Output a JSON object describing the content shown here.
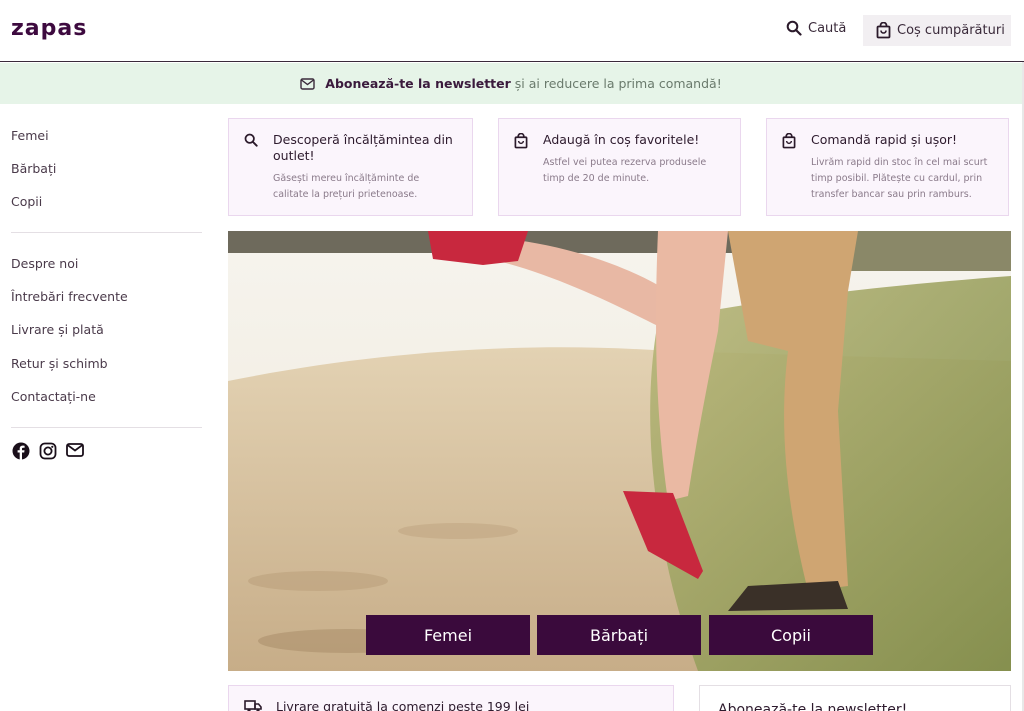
{
  "header": {
    "logo": "zapas",
    "search_label": "Caută",
    "cart_label": "Coș cumpărături"
  },
  "newsletter_bar": {
    "bold": "Abonează-te la newsletter",
    "rest": "și ai reducere la prima comandă!"
  },
  "sidebar": {
    "categories": [
      "Femei",
      "Bărbați",
      "Copii"
    ],
    "pages": [
      "Despre noi",
      "Întrebări frecvente",
      "Livrare și plată",
      "Retur și schimb",
      "Contactați-ne"
    ]
  },
  "cards": [
    {
      "icon": "search-icon",
      "title": "Descoperă încălțămintea din outlet!",
      "desc": "Găsești mereu încălțăminte de calitate la prețuri prietenoase."
    },
    {
      "icon": "shopping-bag-icon",
      "title": "Adaugă în coș favoritele!",
      "desc": "Astfel vei putea rezerva produsele timp de 20 de minute."
    },
    {
      "icon": "shopping-bag-icon",
      "title": "Comandă rapid și ușor!",
      "desc": "Livrăm rapid din stoc în cel mai scurt timp posibil. Plătește cu cardul, prin transfer bancar sau prin ramburs."
    }
  ],
  "hero": {
    "buttons": [
      "Femei",
      "Bărbați",
      "Copii"
    ]
  },
  "bottom": {
    "delivery_text": "Livrare gratuită la comenzi peste 199 lei",
    "newsletter_title": "Abonează-te la newsletter!"
  },
  "colors": {
    "brand": "#3d0a3f",
    "banner_bg": "#e6f4e8",
    "card_bg": "#fbf5fc"
  }
}
